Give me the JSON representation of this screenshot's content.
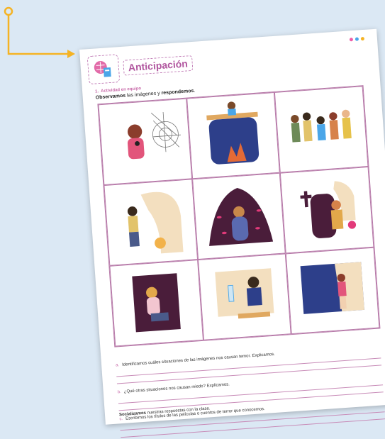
{
  "header": {
    "title": "Anticipación"
  },
  "activity": {
    "number": "1.",
    "label": "Actividad en equipo",
    "instruction_bold1": "Observamos",
    "instruction_mid": " las imágenes y ",
    "instruction_bold2": "respondemos",
    "instruction_end": "."
  },
  "images": [
    "spider-web-fear-icon",
    "diving-board-fear-icon",
    "crowd-fear-icon",
    "monster-shadow-fear-icon",
    "dark-eyes-fear-icon",
    "graveyard-fear-icon",
    "claustrophobia-fear-icon",
    "injection-fear-icon",
    "heights-fear-icon"
  ],
  "questions": [
    {
      "letter": "a.",
      "text": "Identificamos cuáles situaciones de las imágenes nos causan temor. Explicamos."
    },
    {
      "letter": "b.",
      "text": "¿Qué otras situaciones nos causan miedo? Explicamos."
    },
    {
      "letter": "c.",
      "text": "Escribimos los títulos de las películas o cuentos de terror que conocemos."
    }
  ],
  "footer": {
    "bold": "Socializamos",
    "rest": " nuestras respuestas con la clase."
  },
  "colors": {
    "accent": "#b1579f",
    "arrow": "#f5b324",
    "background": "#dbe8f4"
  }
}
